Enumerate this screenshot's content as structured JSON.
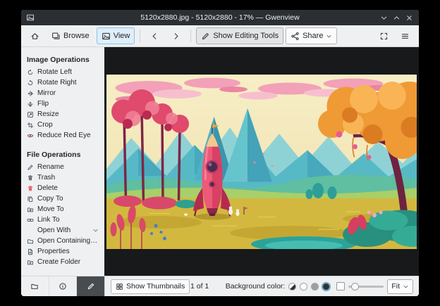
{
  "window": {
    "title": "5120x2880.jpg - 5120x2880 - 17% — Gwenview"
  },
  "colors": {
    "accent": "#3daee6",
    "titlebar_bg": "#2b2f33",
    "chrome_bg": "#eff0f1",
    "viewer_bg": "#17191b",
    "delete_red": "#da4453"
  },
  "toolbar": {
    "browse_label": "Browse",
    "view_label": "View",
    "editing_tools_label": "Show Editing Tools",
    "share_label": "Share",
    "icons": [
      "home-icon",
      "browse-icon",
      "view-icon",
      "back-icon",
      "forward-icon",
      "edit-icon",
      "share-icon",
      "fit-view-icon",
      "menu-icon"
    ]
  },
  "sidebar": {
    "image_operations_title": "Image Operations",
    "image_operations": [
      {
        "label": "Rotate Left",
        "icon": "rotate-left-icon"
      },
      {
        "label": "Rotate Right",
        "icon": "rotate-right-icon"
      },
      {
        "label": "Mirror",
        "icon": "mirror-icon"
      },
      {
        "label": "Flip",
        "icon": "flip-icon"
      },
      {
        "label": "Resize",
        "icon": "resize-icon"
      },
      {
        "label": "Crop",
        "icon": "crop-icon"
      },
      {
        "label": "Reduce Red Eye",
        "icon": "red-eye-icon"
      }
    ],
    "file_operations_title": "File Operations",
    "file_operations": [
      {
        "label": "Rename",
        "icon": "rename-icon"
      },
      {
        "label": "Trash",
        "icon": "trash-icon"
      },
      {
        "label": "Delete",
        "icon": "delete-icon"
      },
      {
        "label": "Copy To",
        "icon": "copy-icon"
      },
      {
        "label": "Move To",
        "icon": "move-icon"
      },
      {
        "label": "Link To",
        "icon": "link-icon"
      },
      {
        "label": "Open With",
        "icon": "none",
        "has_submenu": true
      },
      {
        "label": "Open Containing Folder",
        "icon": "open-folder-icon"
      },
      {
        "label": "Properties",
        "icon": "properties-icon"
      },
      {
        "label": "Create Folder",
        "icon": "new-folder-icon"
      }
    ],
    "tabs": [
      {
        "name": "folders",
        "icon": "folder-icon",
        "active": false
      },
      {
        "name": "information",
        "icon": "info-icon",
        "active": false
      },
      {
        "name": "operations",
        "icon": "pencil-icon",
        "active": true
      }
    ]
  },
  "statusbar": {
    "show_thumbnails_label": "Show Thumbnails",
    "counter": "1 of 1",
    "background_color_label": "Background color:",
    "swatches": [
      {
        "name": "auto"
      },
      {
        "name": "light",
        "color": "#fcfcfc"
      },
      {
        "name": "gray",
        "color": "#9da0a2"
      },
      {
        "name": "dark",
        "color": "#2e3134",
        "selected": true
      }
    ],
    "zoom_mode": "Fit"
  },
  "image": {
    "description": "Colorful flat illustration of a pink rocket standing in a stylized valley with teal mountains, pink clouds, red and orange trees"
  }
}
